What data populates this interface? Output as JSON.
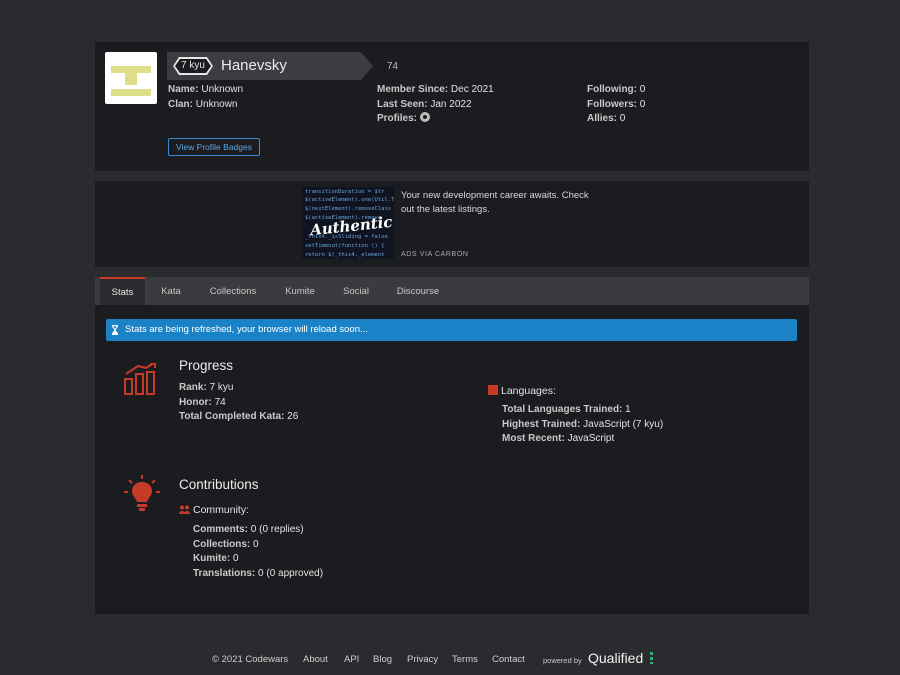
{
  "profile": {
    "rank_badge": "7 kyu",
    "username": "Hanevsky",
    "honor": "74",
    "name_label": "Name:",
    "name_value": "Unknown",
    "clan_label": "Clan:",
    "clan_value": "Unknown",
    "member_since_label": "Member Since:",
    "member_since_value": "Dec 2021",
    "last_seen_label": "Last Seen:",
    "last_seen_value": "Jan 2022",
    "profiles_label": "Profiles:",
    "profiles_icon": "github-icon",
    "following_label": "Following:",
    "following_value": "0",
    "followers_label": "Followers:",
    "followers_value": "0",
    "allies_label": "Allies:",
    "allies_value": "0",
    "badges_button": "View Profile Badges"
  },
  "ad": {
    "image_text": "Authentic",
    "text": "Your new development career awaits. Check out the latest listings.",
    "via": "ADS VIA CARBON"
  },
  "tabs": [
    {
      "label": "Stats",
      "active": true
    },
    {
      "label": "Kata",
      "active": false
    },
    {
      "label": "Collections",
      "active": false
    },
    {
      "label": "Kumite",
      "active": false
    },
    {
      "label": "Social",
      "active": false
    },
    {
      "label": "Discourse",
      "active": false
    }
  ],
  "stats": {
    "alert": "Stats are being refreshed, your browser will reload soon...",
    "progress": {
      "title": "Progress",
      "rank_label": "Rank:",
      "rank_value": "7 kyu",
      "honor_label": "Honor:",
      "honor_value": "74",
      "completed_label": "Total Completed Kata:",
      "completed_value": "26"
    },
    "languages": {
      "title": "Languages:",
      "total_label": "Total Languages Trained:",
      "total_value": "1",
      "highest_label": "Highest Trained:",
      "highest_value": "JavaScript (7 kyu)",
      "recent_label": "Most Recent:",
      "recent_value": "JavaScript"
    },
    "contributions": {
      "title": "Contributions",
      "community_title": "Community:",
      "comments_label": "Comments:",
      "comments_value": "0 (0 replies)",
      "collections_label": "Collections:",
      "collections_value": "0",
      "kumite_label": "Kumite:",
      "kumite_value": "0",
      "translations_label": "Translations:",
      "translations_value": "0 (0 approved)"
    }
  },
  "footer": {
    "copyright": "© 2021 Codewars",
    "links": [
      "About",
      "API",
      "Blog",
      "Privacy",
      "Terms",
      "Contact"
    ],
    "powered_by": "powered by",
    "brand": "Qualified"
  },
  "colors": {
    "accent_red": "#c83a28",
    "alert_blue": "#1a82c7",
    "link_blue": "#3c8ad1",
    "panel": "#1b1c1f",
    "background": "#2a2b2e"
  }
}
